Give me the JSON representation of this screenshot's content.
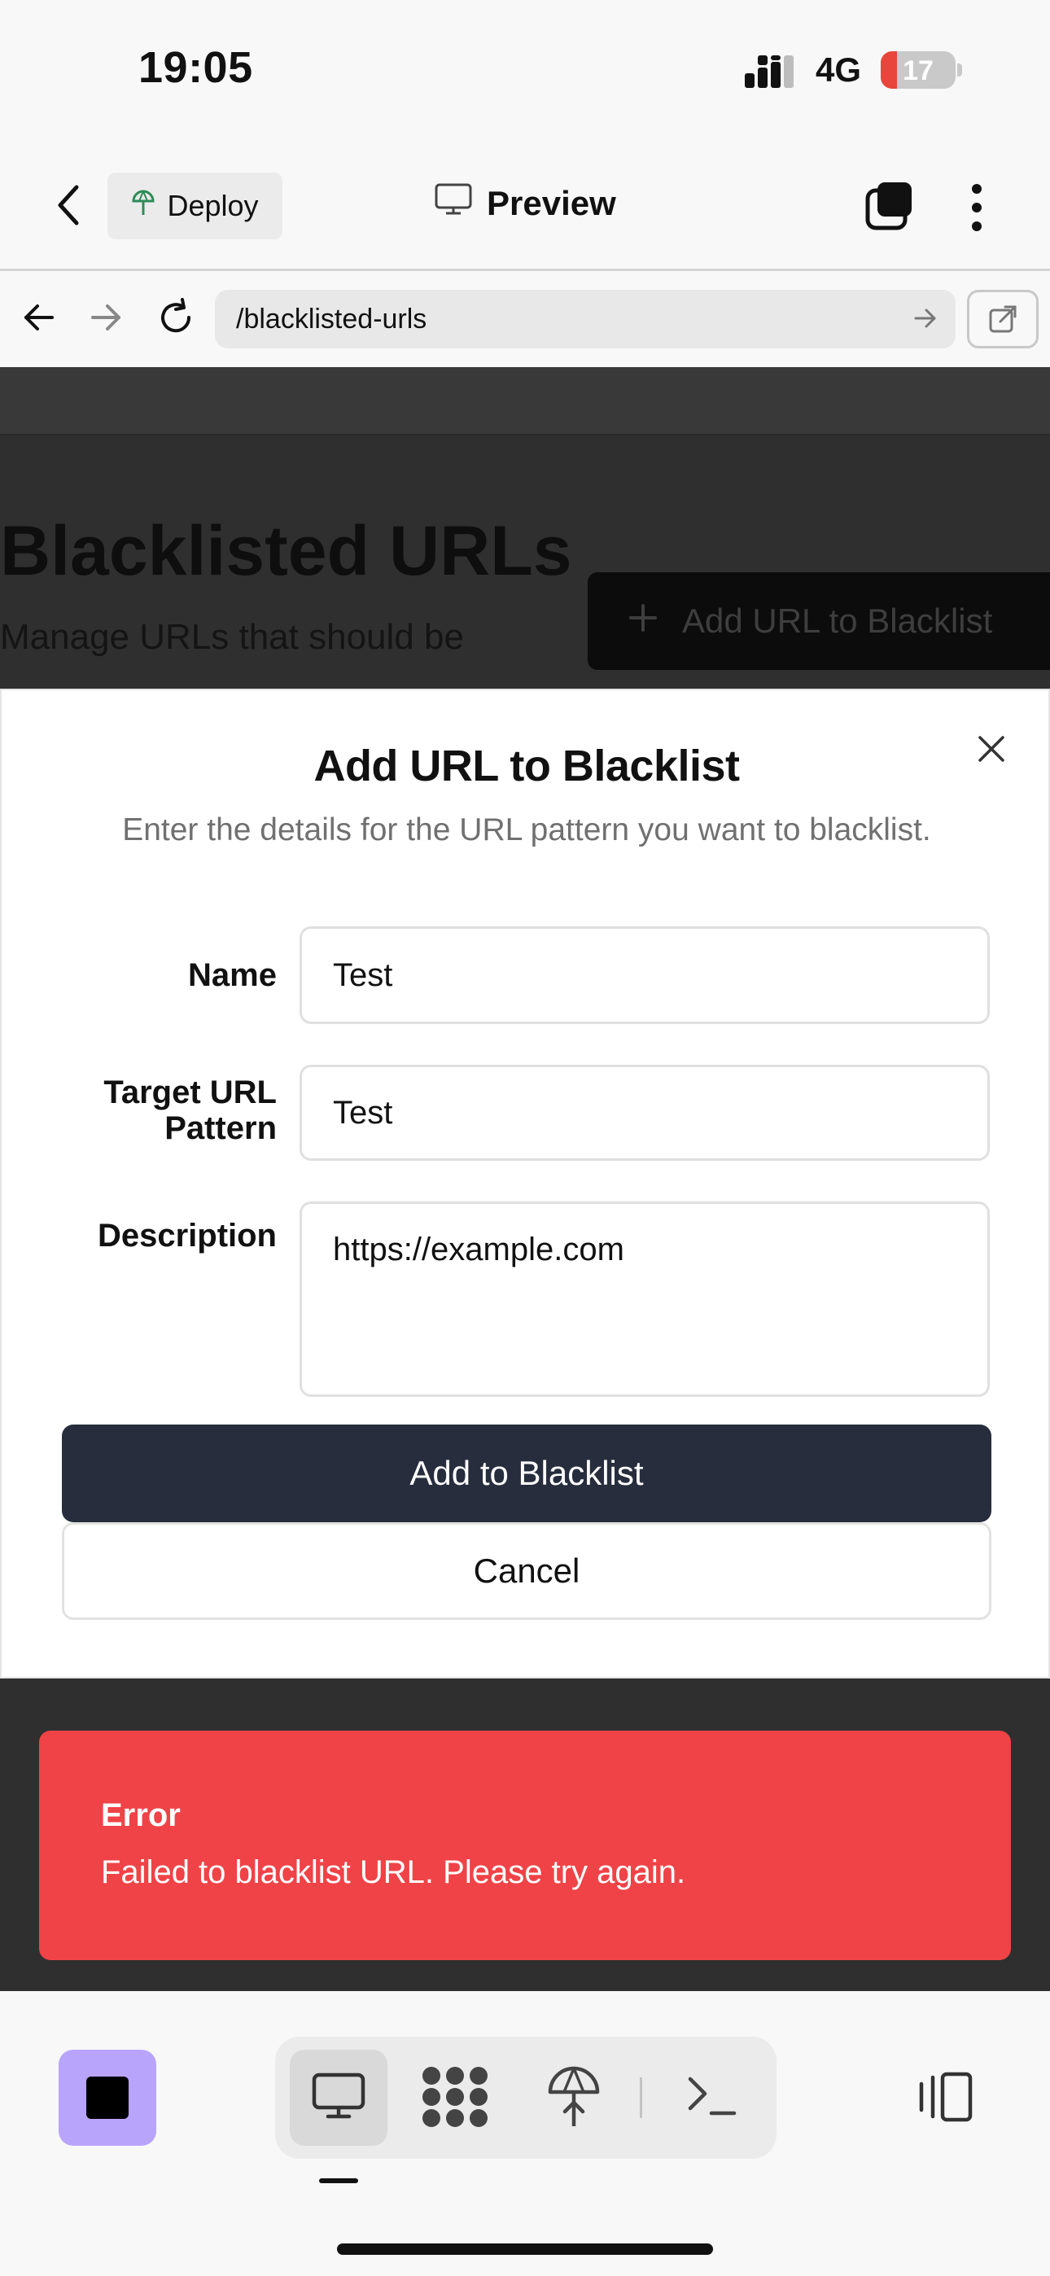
{
  "status_bar": {
    "time": "19:05",
    "network": "4G",
    "battery": "17"
  },
  "header": {
    "deploy_label": "Deploy",
    "title": "Preview"
  },
  "browser": {
    "url": "/blacklisted-urls"
  },
  "page": {
    "title": "Blacklisted URLs",
    "subtitle": "Manage URLs that should be",
    "add_button_label": "Add URL to Blacklist"
  },
  "modal": {
    "title": "Add URL to Blacklist",
    "description": "Enter the details for the URL pattern you want to blacklist.",
    "fields": {
      "name": {
        "label": "Name",
        "value": "Test"
      },
      "url_pattern": {
        "label_line1": "Target URL",
        "label_line2": "Pattern",
        "value": "Test"
      },
      "description": {
        "label": "Description",
        "value": "https://example.com"
      }
    },
    "submit_label": "Add to Blacklist",
    "cancel_label": "Cancel"
  },
  "toast": {
    "title": "Error",
    "message": "Failed to blacklist URL. Please try again."
  },
  "colors": {
    "accent_purple": "#b9a4fb",
    "error_red": "#ef4347",
    "primary_button": "#272d3d"
  },
  "icons": {
    "bottom_tabs": [
      "monitor-icon",
      "workflows-icon",
      "deploy-icon",
      "shell-icon"
    ],
    "split_view": "split-view-icon"
  }
}
